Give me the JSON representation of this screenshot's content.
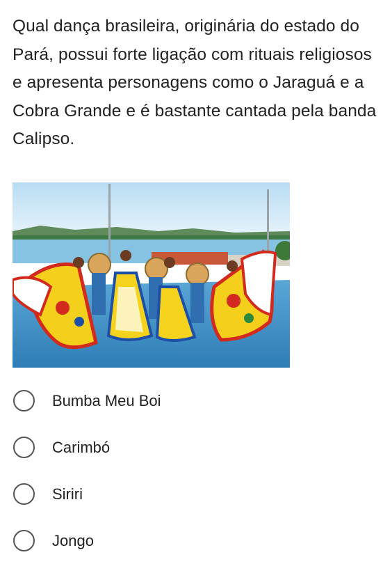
{
  "question": {
    "text": "Qual dança brasileira, originária do estado do Pará, possui forte ligação com rituais religiosos e apresenta personagens como o Jaraguá e a Cobra Grande e é bastante cantada pela banda Calipso."
  },
  "image": {
    "icon": "photo-of-dancers",
    "colors": {
      "sky": "#cfe6f6",
      "water": "#7fc0e2",
      "floor": "#3f8fc6",
      "skirt_yellow": "#f6d21a",
      "skirt_red": "#d62a1d"
    }
  },
  "options": [
    {
      "label": "Bumba Meu Boi",
      "selected": false
    },
    {
      "label": "Carimbó",
      "selected": false
    },
    {
      "label": "Siriri",
      "selected": false
    },
    {
      "label": "Jongo",
      "selected": false
    }
  ]
}
